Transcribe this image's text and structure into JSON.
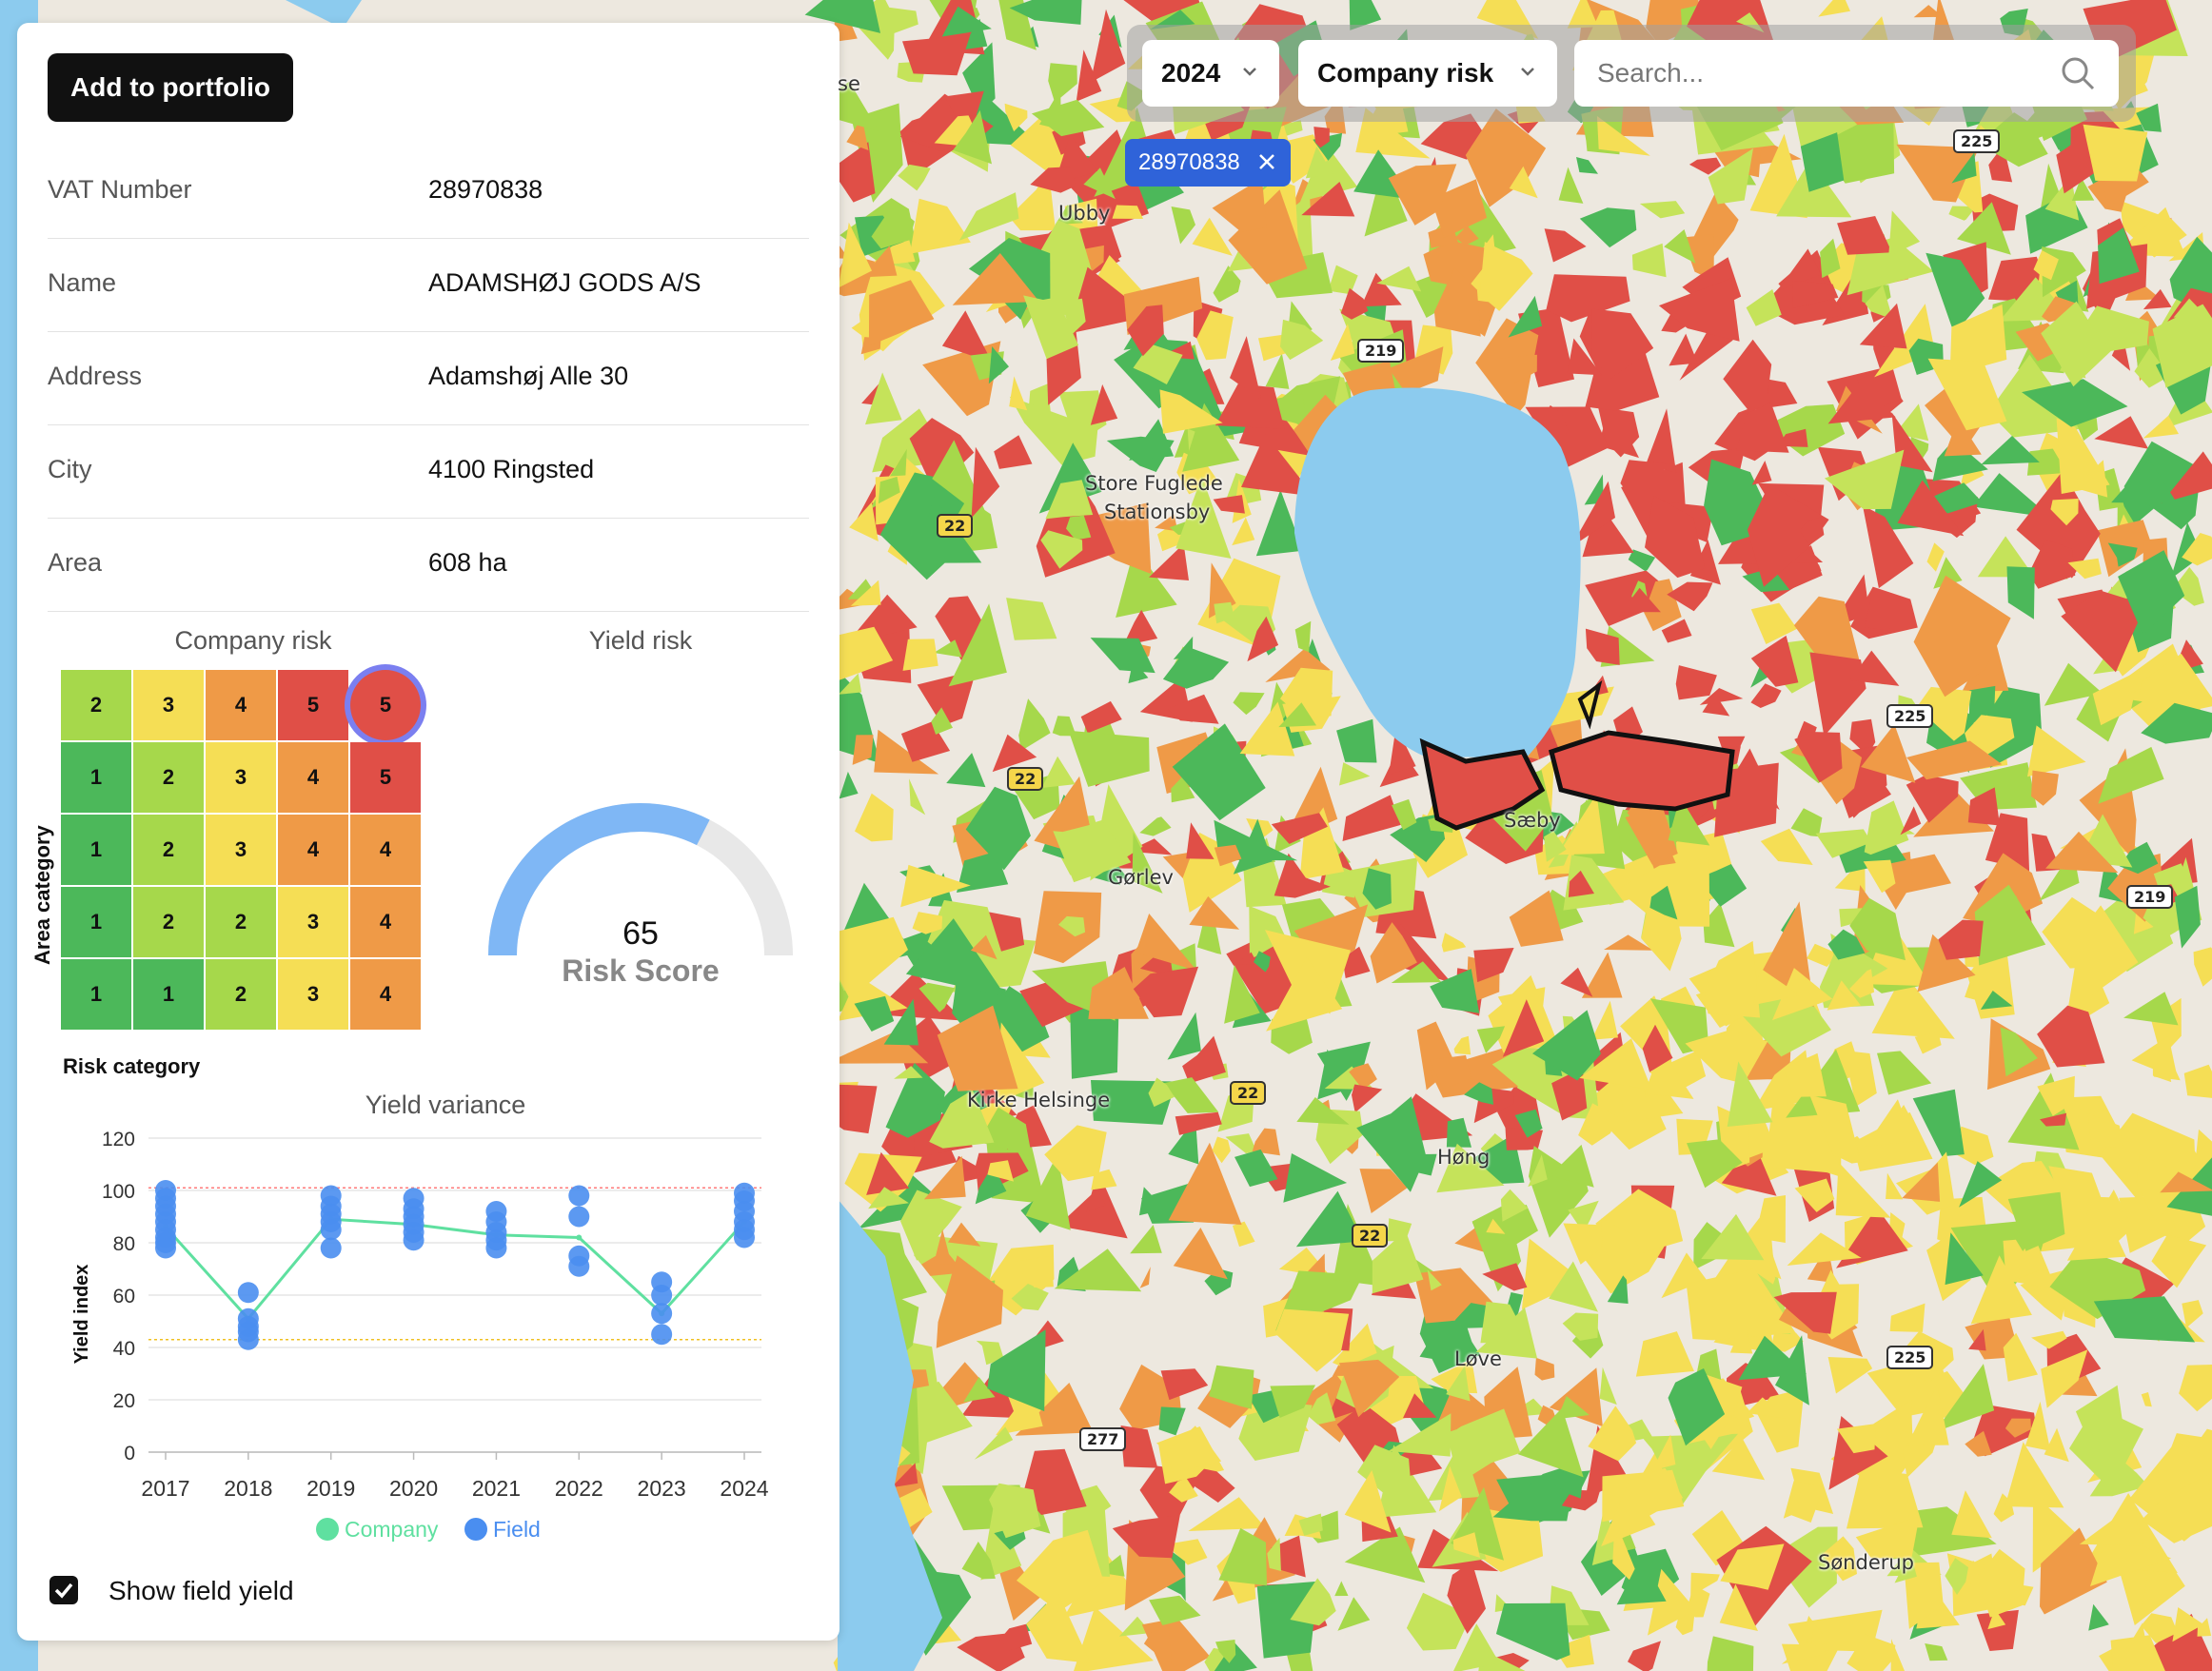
{
  "portfolio_button": "Add to portfolio",
  "company": {
    "rows": [
      {
        "label": "VAT Number",
        "value": "28970838"
      },
      {
        "label": "Name",
        "value": "ADAMSHØJ GODS A/S"
      },
      {
        "label": "Address",
        "value": "Adamshøj Alle 30"
      },
      {
        "label": "City",
        "value": "4100 Ringsted"
      },
      {
        "label": "Area",
        "value": "608 ha"
      }
    ]
  },
  "company_risk": {
    "title": "Company risk",
    "y_label": "Area category",
    "x_label": "Risk category",
    "matrix": [
      [
        2,
        3,
        4,
        5,
        5
      ],
      [
        1,
        2,
        3,
        4,
        5
      ],
      [
        1,
        2,
        3,
        4,
        4
      ],
      [
        1,
        2,
        2,
        3,
        4
      ],
      [
        1,
        1,
        2,
        3,
        4
      ]
    ],
    "highlight": {
      "row": 0,
      "col": 4
    },
    "colors": {
      "1": "#4cb85a",
      "2": "#a6d84b",
      "3": "#f5de55",
      "4": "#ef9a47",
      "5": "#e04f47"
    }
  },
  "yield_risk": {
    "title": "Yield risk",
    "score": "65",
    "score_label": "Risk Score",
    "fraction": 0.65,
    "colors": {
      "fill": "#7fb7f5",
      "track": "#e8e8e8"
    }
  },
  "chart_data": {
    "type": "line",
    "title": "Yield variance",
    "ylabel": "Yield index",
    "xlabel": "",
    "ylim": [
      0,
      120
    ],
    "yticks": [
      "0",
      "20",
      "40",
      "60",
      "80",
      "100",
      "120"
    ],
    "categories": [
      "2017",
      "2018",
      "2019",
      "2020",
      "2021",
      "2022",
      "2023",
      "2024"
    ],
    "series": [
      {
        "name": "Company",
        "color": "#5fe0a0",
        "values": [
          86,
          51,
          89,
          87,
          83,
          82,
          53,
          88
        ]
      },
      {
        "name": "Field",
        "color": "#4a8ef0",
        "type": "scatter",
        "points": [
          [
            100,
            97,
            94,
            91,
            88,
            85,
            82,
            80,
            78
          ],
          [
            61,
            51,
            48,
            46,
            43
          ],
          [
            98,
            94,
            91,
            88,
            85,
            78
          ],
          [
            97,
            93,
            90,
            87,
            84,
            81
          ],
          [
            92,
            88,
            84,
            81,
            78
          ],
          [
            98,
            90,
            75,
            71
          ],
          [
            65,
            60,
            53,
            45
          ],
          [
            99,
            96,
            92,
            88,
            85,
            82
          ]
        ]
      }
    ],
    "reference_lines": [
      {
        "value": 101,
        "color": "#ff7a7a"
      },
      {
        "value": 43,
        "color": "#f0c020"
      }
    ]
  },
  "field_yield_toggle": {
    "label": "Show field yield",
    "checked": true
  },
  "toolbar": {
    "year": "2024",
    "layer": "Company risk",
    "search_placeholder": "Search..."
  },
  "filter_chip": "28970838",
  "map": {
    "places": [
      "Ubby",
      "Store Fuglede",
      "Stationsby",
      "Sæby",
      "Gørlev",
      "Kirke Helsinge",
      "Høng",
      "Løve",
      "Sønderup",
      "se"
    ],
    "roads": [
      "225",
      "219",
      "22",
      "225",
      "219",
      "22",
      "22",
      "22",
      "277",
      "225"
    ],
    "lake_color": "#8ccbee",
    "sea_color": "#8ccbee"
  }
}
